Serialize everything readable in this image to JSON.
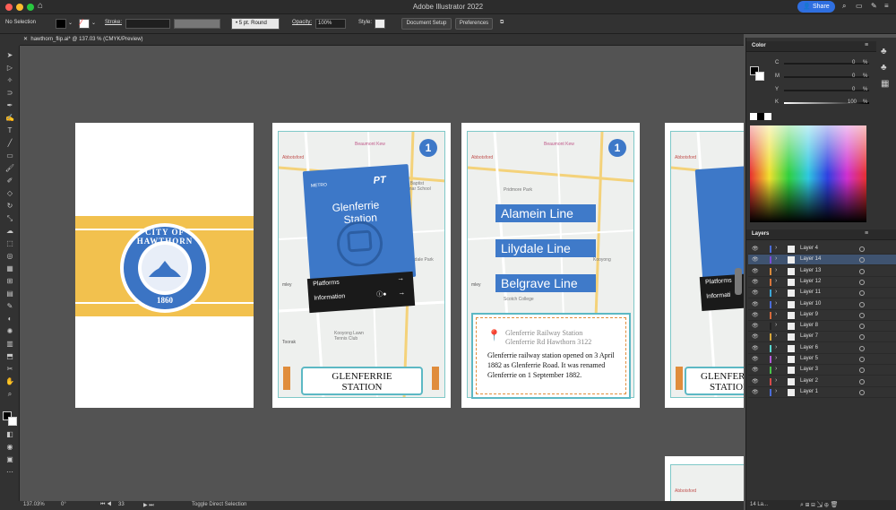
{
  "app": {
    "title": "Adobe Illustrator 2022",
    "share_label": "Share"
  },
  "controlbar": {
    "selection": "No Selection",
    "stroke_label": "Stroke:",
    "brush_label": "5 pt. Round",
    "opacity_label": "Opacity:",
    "opacity_value": "100%",
    "style_label": "Style:",
    "doc_setup": "Document Setup",
    "preferences": "Preferences"
  },
  "document": {
    "tab": "hawthorn_flip.ai* @ 137.03 % (CMYK/Preview)"
  },
  "status": {
    "zoom": "137.03%",
    "angle": "0°",
    "artboard": "33",
    "tool": "Toggle Direct Selection"
  },
  "artboards": {
    "seal": {
      "text": "CITY OF HAWTHORN",
      "year": "1860"
    },
    "card2": {
      "badge": "1",
      "sign_brand": "METRO",
      "sign_pt": "PT",
      "sign_title1": "Glenferrie",
      "sign_title2": "Station",
      "sign_row1": "Platforms",
      "sign_row2": "Information",
      "banner1": "GLENFERRIE",
      "banner2": "STATION",
      "map_labels": [
        "Beaumont Kew",
        "Abbotsford",
        "Carey Baptist Grammar School",
        "Kooyong Lawn Tennis Club",
        "Toorak",
        "Riverdale Park",
        "mley"
      ]
    },
    "card3": {
      "badge": "1",
      "lines": [
        "Alamein Line",
        "Lilydale Line",
        "Belgrave Line"
      ],
      "addr1": "Glenferrie Railway Station",
      "addr2": "Glenferrie Rd Hawthorn 3122",
      "desc": "Glenferrie railway station opened on 3 April 1882 as Glenferrie Road. It was renamed Glenferrie on 1 September 1882.",
      "map_labels": [
        "Beaumont Kew",
        "Abbotsford",
        "Pridmore Park",
        "Hawthorn Tram Museum",
        "Scotch College",
        "Kooyong",
        "mley"
      ]
    },
    "card4": {
      "sign_row1": "Platforms",
      "sign_row2": "Informati",
      "banner1": "GLENFERRIE",
      "banner2": "STATION",
      "map_labels": [
        "Abbotsford"
      ]
    },
    "card5": {
      "map_labels": [
        "Abbotsford"
      ]
    }
  },
  "color_panel": {
    "title": "Color",
    "channels": [
      {
        "label": "C",
        "value": "0",
        "unit": "%"
      },
      {
        "label": "M",
        "value": "0",
        "unit": "%"
      },
      {
        "label": "Y",
        "value": "0",
        "unit": "%"
      },
      {
        "label": "K",
        "value": "100",
        "unit": "%"
      }
    ]
  },
  "layers_panel": {
    "title": "Layers",
    "footer": "14 La...",
    "layers": [
      {
        "name": "Layer 4",
        "color": "#4b6cd8"
      },
      {
        "name": "Layer 14",
        "color": "#7b4bd8"
      },
      {
        "name": "Layer 13",
        "color": "#d88a3c"
      },
      {
        "name": "Layer 12",
        "color": "#d8743c"
      },
      {
        "name": "Layer 11",
        "color": "#3ca7d8"
      },
      {
        "name": "Layer 10",
        "color": "#4b6cd8"
      },
      {
        "name": "Layer 9",
        "color": "#d86a3c"
      },
      {
        "name": "Layer 8",
        "color": "#222222"
      },
      {
        "name": "Layer 7",
        "color": "#d8a83c"
      },
      {
        "name": "Layer 6",
        "color": "#58d8d0"
      },
      {
        "name": "Layer 5",
        "color": "#b45cd8"
      },
      {
        "name": "Layer 3",
        "color": "#49c64b"
      },
      {
        "name": "Layer 2",
        "color": "#d84b4b"
      },
      {
        "name": "Layer 1",
        "color": "#4b6cd8"
      }
    ]
  }
}
